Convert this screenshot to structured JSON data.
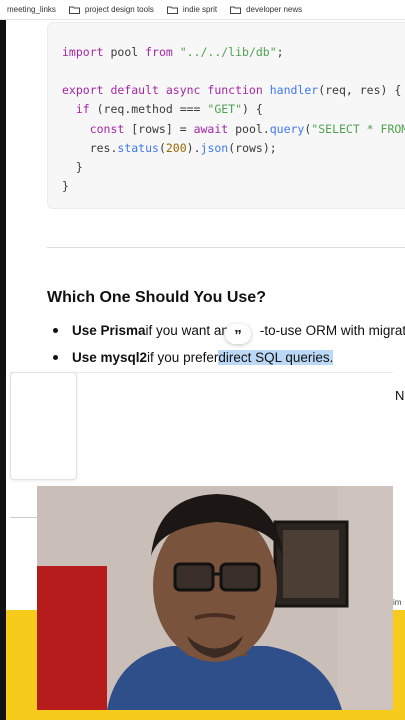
{
  "bookmarks": [
    {
      "label": "meeting_links",
      "icon": "none"
    },
    {
      "label": "project design tools",
      "icon": "folder-icon"
    },
    {
      "label": "indie sprit",
      "icon": "folder-icon"
    },
    {
      "label": "developer news",
      "icon": "folder-icon"
    }
  ],
  "code": {
    "line1_kw": "import",
    "line1_a": " pool ",
    "line1_kw2": "from",
    "line1_str": " \"../../lib/db\"",
    "line1_end": ";",
    "line2_kw": "export default async function",
    "line2_fn": " handler",
    "line2_rest": "(req, res) {",
    "line3_kw": "  if",
    "line3_a": " (req.method === ",
    "line3_str": "\"GET\"",
    "line3_end": ") {",
    "line4_kw": "    const",
    "line4_a": " [rows] = ",
    "line4_kw2": "await",
    "line4_b": " pool.",
    "line4_fn": "query",
    "line4_c": "(",
    "line4_str": "\"SELECT * FROM ",
    "line5_a": "    res.",
    "line5_fn": "status",
    "line5_b": "(",
    "line5_num": "200",
    "line5_c": ").",
    "line5_fn2": "json",
    "line5_d": "(rows);",
    "line6": "  }",
    "line7": "}"
  },
  "content": {
    "heading": "Which One Should You Use?",
    "bullet1_bold": "Use Prisma",
    "bullet1_a": " if you want an",
    "bullet1_b": "-to-use ORM with migratio",
    "bullet2_bold": "Use mysql2",
    "bullet2_a": " if you prefer ",
    "bullet2_hl": "direct SQL queries.",
    "quote_glyph": "”"
  },
  "overlay": {
    "peek_text": "N",
    "peek_small": "im"
  },
  "colors": {
    "highlight": "#bcd8f7",
    "yellow": "#f7cb1b",
    "code_bg": "#f7f7f8"
  }
}
